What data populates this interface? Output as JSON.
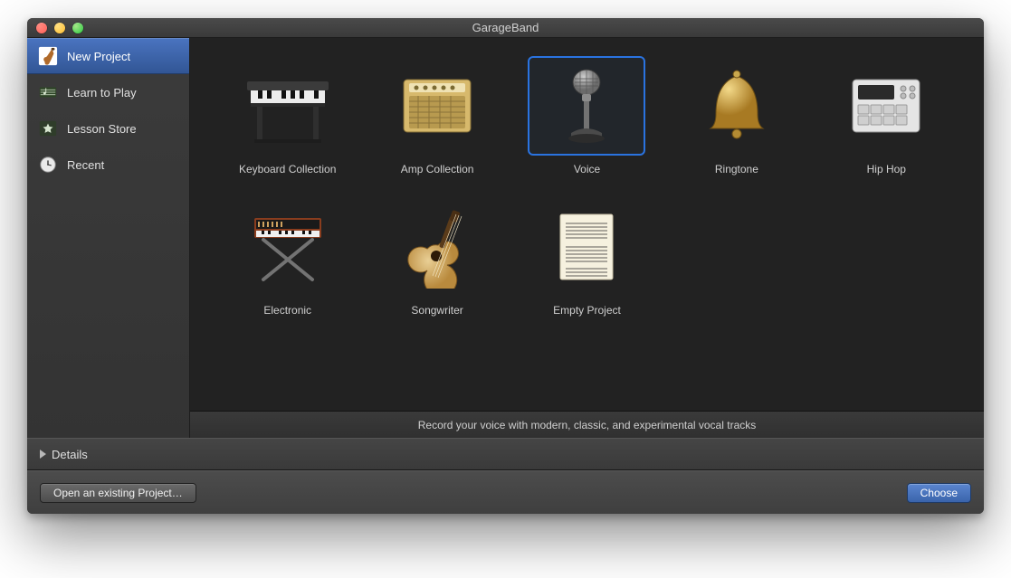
{
  "window": {
    "title": "GarageBand"
  },
  "sidebar": {
    "items": [
      {
        "id": "new-project",
        "label": "New Project",
        "selected": true,
        "icon": "guitar-icon"
      },
      {
        "id": "learn-to-play",
        "label": "Learn to Play",
        "selected": false,
        "icon": "score-icon"
      },
      {
        "id": "lesson-store",
        "label": "Lesson Store",
        "selected": false,
        "icon": "star-icon"
      },
      {
        "id": "recent",
        "label": "Recent",
        "selected": false,
        "icon": "clock-icon"
      }
    ]
  },
  "templates": [
    {
      "id": "keyboard-collection",
      "label": "Keyboard Collection",
      "icon": "piano-icon",
      "selected": false
    },
    {
      "id": "amp-collection",
      "label": "Amp Collection",
      "icon": "amp-icon",
      "selected": false
    },
    {
      "id": "voice",
      "label": "Voice",
      "icon": "microphone-icon",
      "selected": true
    },
    {
      "id": "ringtone",
      "label": "Ringtone",
      "icon": "bell-icon",
      "selected": false
    },
    {
      "id": "hip-hop",
      "label": "Hip Hop",
      "icon": "drum-machine-icon",
      "selected": false
    },
    {
      "id": "electronic",
      "label": "Electronic",
      "icon": "synth-icon",
      "selected": false
    },
    {
      "id": "songwriter",
      "label": "Songwriter",
      "icon": "acoustic-guitar-icon",
      "selected": false
    },
    {
      "id": "empty-project",
      "label": "Empty Project",
      "icon": "sheet-music-icon",
      "selected": false
    }
  ],
  "description": "Record your voice with modern, classic, and experimental vocal tracks",
  "details": {
    "label": "Details"
  },
  "footer": {
    "open_existing_label": "Open an existing Project…",
    "choose_label": "Choose"
  },
  "colors": {
    "accent": "#2a73e0",
    "sidebar_selected": "#3c66aa"
  }
}
